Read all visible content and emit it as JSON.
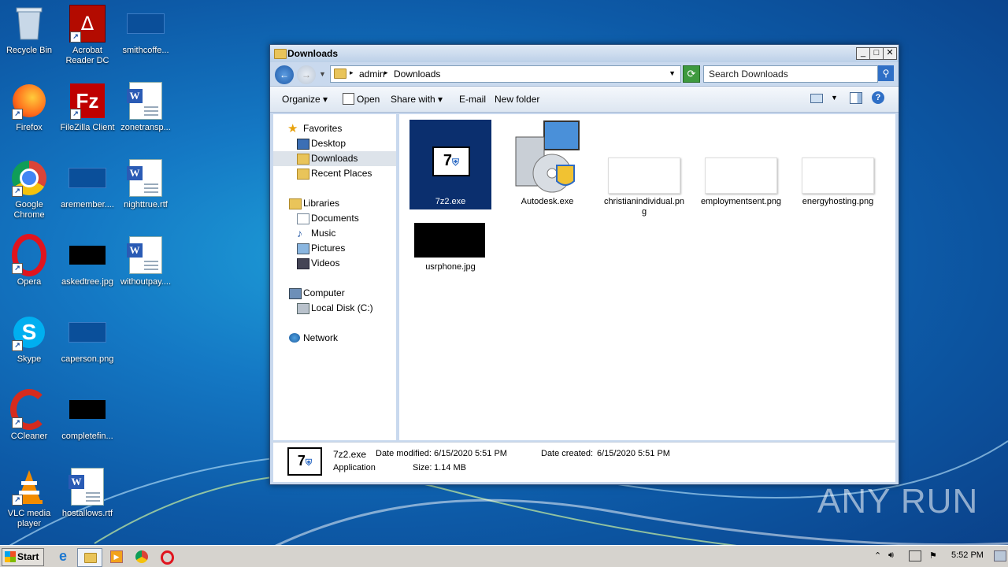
{
  "desktop": {
    "icons": [
      {
        "label": "Recycle Bin"
      },
      {
        "label": "Acrobat Reader DC"
      },
      {
        "label": "smithcoffe..."
      },
      {
        "label": "Firefox"
      },
      {
        "label": "FileZilla Client"
      },
      {
        "label": "zonetransp..."
      },
      {
        "label": "Google Chrome"
      },
      {
        "label": "aremember...."
      },
      {
        "label": "nighttrue.rtf"
      },
      {
        "label": "Opera"
      },
      {
        "label": "askedtree.jpg"
      },
      {
        "label": "withoutpay...."
      },
      {
        "label": "Skype"
      },
      {
        "label": "caperson.png"
      },
      {
        "label": "CCleaner"
      },
      {
        "label": "completefin..."
      },
      {
        "label": "VLC media player"
      },
      {
        "label": "hostallows.rtf"
      }
    ]
  },
  "window": {
    "title": "Downloads",
    "breadcrumb": [
      "admin",
      "Downloads"
    ],
    "search_placeholder": "Search Downloads",
    "toolbar": {
      "organize": "Organize",
      "open": "Open",
      "share_with": "Share with",
      "email": "E-mail",
      "new_folder": "New folder"
    },
    "nav": {
      "favorites": "Favorites",
      "desktop": "Desktop",
      "downloads": "Downloads",
      "recent": "Recent Places",
      "libraries": "Libraries",
      "documents": "Documents",
      "music": "Music",
      "pictures": "Pictures",
      "videos": "Videos",
      "computer": "Computer",
      "localdisk": "Local Disk (C:)",
      "network": "Network"
    },
    "files": [
      {
        "name": "7z2.exe",
        "selected": true
      },
      {
        "name": "Autodesk.exe"
      },
      {
        "name": "christianindividual.png"
      },
      {
        "name": "employmentsent.png"
      },
      {
        "name": "energyhosting.png"
      },
      {
        "name": "usrphone.jpg"
      }
    ],
    "details": {
      "name": "7z2.exe",
      "type": "Application",
      "modified_label": "Date modified:",
      "modified": "6/15/2020 5:51 PM",
      "created_label": "Date created:",
      "created": "6/15/2020 5:51 PM",
      "size_label": "Size:",
      "size": "1.14 MB"
    }
  },
  "taskbar": {
    "start": "Start",
    "clock": "5:52 PM"
  },
  "watermark": "ANY RUN"
}
